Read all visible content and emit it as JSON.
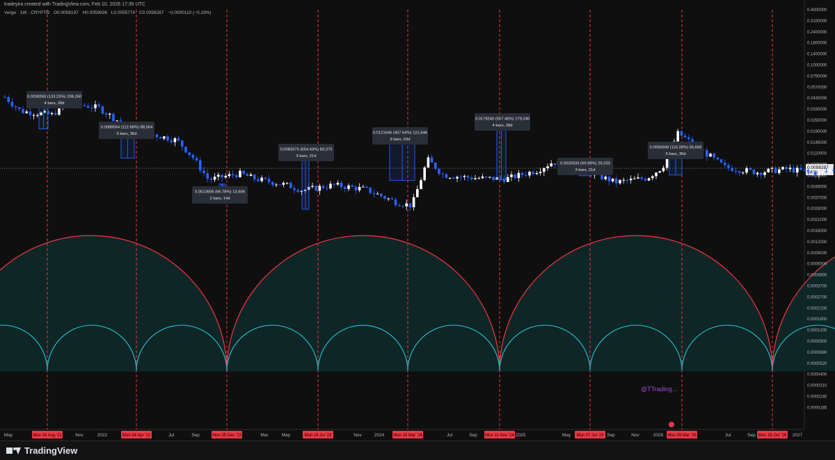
{
  "header": {
    "author_line": "tradeyira created with TradingView.com, Feb 10, 2026 17:35 UTC",
    "symbol": "Verge · 1W · CRYPTO",
    "ohlc": [
      "O0.0058197",
      "H0.0059936",
      "L0.0055774",
      "C0.0058287",
      "−0.0000110 (−0.19%)"
    ]
  },
  "footer": {
    "brand": "TradingView",
    "watermark": "@TTrading..."
  },
  "colors": {
    "bg": "#0f0f0f",
    "up": "#ffffff",
    "down": "#2962ff",
    "cycle": "#f23645",
    "subcycle": "#22c9d6",
    "box": "#2962ff",
    "fill": "#0f2a2c"
  },
  "chart_data": {
    "type": "candlestick",
    "title": "",
    "y_scale": "log",
    "y_tick_labels": [
      "0.4000000",
      "0.3100000",
      "0.2400000",
      "0.1800000",
      "0.1400000",
      "0.1000000",
      "0.0750000",
      "0.0570000",
      "0.0430000",
      "0.0330000",
      "0.0250000",
      "0.0190000",
      "0.0145000",
      "0.0110000",
      "0.0085000",
      "0.0065000",
      "0.0049000",
      "0.0037000",
      "0.0028000",
      "0.0021000",
      "0.0016000",
      "0.0012000",
      "0.0009000",
      "0.0006500",
      "0.0004900",
      "0.0003700",
      "0.0002700",
      "0.0002100",
      "0.0001600",
      "0.0001200",
      "0.0000900",
      "0.0000680",
      "0.0000520",
      "0.0000400",
      "0.0000310",
      "0.0000240",
      "0.0000185"
    ],
    "last_price": "0.0058287",
    "last_price_countdown": "5d 7h",
    "x_tick_labels": [
      "May",
      "Nov",
      "2022",
      "Jul",
      "Sep",
      "Mar",
      "May",
      "Nov",
      "2024",
      "Jul",
      "Sep",
      "2025",
      "May",
      "Sep",
      "Nov",
      "2026",
      "Jul",
      "Sep",
      "2027"
    ],
    "cycle_dates": [
      "Mon 16 Aug '21",
      "Mon 04 Apr '22",
      "Mon 05 Dec '22",
      "Mon 24 Jul '23",
      "Mon 18 Mar '24",
      "Mon 11 Nov '24",
      "Mon 07 Jul '25",
      "Mon 09 Mar '26",
      "Mon 26 Oct '26"
    ],
    "price_series": [
      {
        "date": "2021-05",
        "price": 0.045
      },
      {
        "date": "2021-06",
        "price": 0.03
      },
      {
        "date": "2021-08",
        "price": 0.027
      },
      {
        "date": "2021-09",
        "price": 0.038
      },
      {
        "date": "2021-11",
        "price": 0.033
      },
      {
        "date": "2022-01",
        "price": 0.018
      },
      {
        "date": "2022-04",
        "price": 0.013
      },
      {
        "date": "2022-05",
        "price": 0.008
      },
      {
        "date": "2022-06",
        "price": 0.0042
      },
      {
        "date": "2022-08",
        "price": 0.005
      },
      {
        "date": "2022-09",
        "price": 0.0043
      },
      {
        "date": "2022-11",
        "price": 0.0036
      },
      {
        "date": "2022-12",
        "price": 0.0031
      },
      {
        "date": "2023-02",
        "price": 0.0036
      },
      {
        "date": "2023-04",
        "price": 0.0032
      },
      {
        "date": "2023-06",
        "price": 0.0022
      },
      {
        "date": "2023-07",
        "price": 0.002
      },
      {
        "date": "2023-08",
        "price": 0.0075
      },
      {
        "date": "2023-09",
        "price": 0.0048
      },
      {
        "date": "2023-11",
        "price": 0.0044
      },
      {
        "date": "2024-01",
        "price": 0.0043
      },
      {
        "date": "2024-03",
        "price": 0.0055
      },
      {
        "date": "2024-04",
        "price": 0.007
      },
      {
        "date": "2024-06",
        "price": 0.0055
      },
      {
        "date": "2024-08",
        "price": 0.0039
      },
      {
        "date": "2024-10",
        "price": 0.0044
      },
      {
        "date": "2024-11",
        "price": 0.006
      },
      {
        "date": "2024-12",
        "price": 0.016
      },
      {
        "date": "2025-01",
        "price": 0.0115
      },
      {
        "date": "2025-03",
        "price": 0.006
      },
      {
        "date": "2025-05",
        "price": 0.0052
      },
      {
        "date": "2025-07",
        "price": 0.0057
      },
      {
        "date": "2025-09",
        "price": 0.005
      },
      {
        "date": "2025-11",
        "price": 0.0065
      },
      {
        "date": "2026-01",
        "price": 0.005
      },
      {
        "date": "2026-02",
        "price": 0.0058
      }
    ],
    "measurements": [
      {
        "text1": "0.0208260 (133.23%) 208,260",
        "text2": "4 bars, 28d",
        "low": 0.018,
        "high": 0.041
      },
      {
        "text1": "0.0088564 (112.68%) 88,564",
        "text2": "5 bars, 35d",
        "low": 0.0078,
        "high": 0.0162
      },
      {
        "text1": "0.0013606 (66.78%) 13,606",
        "text2": "2 bars, 14d",
        "low": 0.003,
        "high": 0.0037
      },
      {
        "text1": "0.0083375 (654.43%) 83,375",
        "text2": "3 bars, 21d",
        "low": 0.0018,
        "high": 0.0092
      },
      {
        "text1": "0.0121646 (407.64%) 121,646",
        "text2": "9 bars, 63d",
        "low": 0.0041,
        "high": 0.0155
      },
      {
        "text1": "0.0179240 (557.46%) 179,240",
        "text2": "4 bars, 28d",
        "low": 0.0042,
        "high": 0.021
      },
      {
        "text1": "0.0029333 (69.98%) 29,333",
        "text2": "3 bars, 21d",
        "low": 0.0047,
        "high": 0.0077
      },
      {
        "text1": "0.0056668 (116.28%) 56,668",
        "text2": "5 bars, 35d",
        "low": 0.0048,
        "high": 0.0104
      }
    ]
  }
}
